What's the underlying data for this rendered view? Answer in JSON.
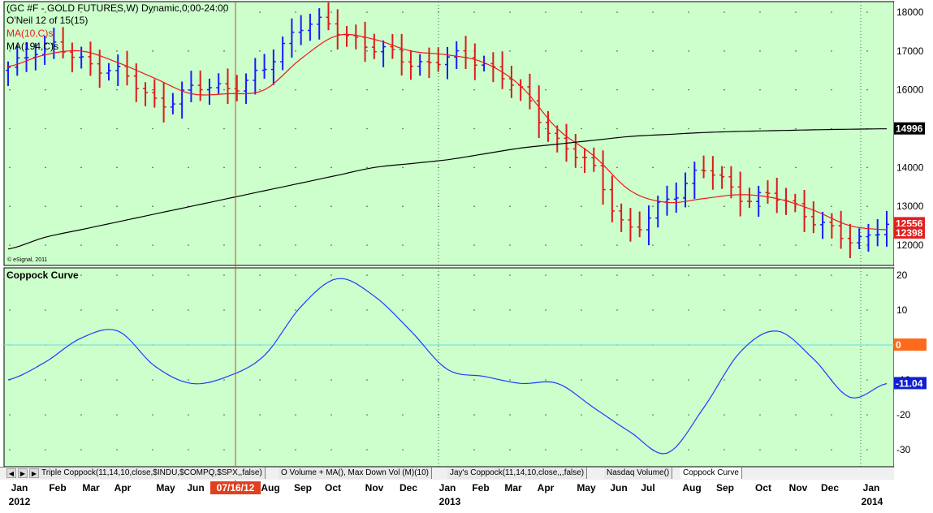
{
  "price_panel": {
    "header_line1": "(GC #F - GOLD FUTURES,W) Dynamic,0:00-24:00",
    "header_line2": "O'Neil 12 of 15(15)",
    "header_line3": "MA(10,C)s",
    "header_line4": "MA(194,C)s",
    "copyright": "© eSignal, 2011",
    "badges": [
      {
        "text": "14996",
        "value": 14996,
        "bg": "#000000",
        "fg": "#ffffff"
      },
      {
        "text": "12556",
        "value": 12556,
        "bg": "#e02020",
        "fg": "#ffffff"
      },
      {
        "text": "12398",
        "value": 12398,
        "bg": "#e02020",
        "fg": "#ffffff"
      }
    ]
  },
  "coppock_panel": {
    "title": "Coppock Curve",
    "badges": [
      {
        "text": "0",
        "value": 0,
        "bg": "#ff6a1a",
        "fg": "#ffffff"
      },
      {
        "text": "-11.04",
        "value": -11.04,
        "bg": "#1020d0",
        "fg": "#ffffff"
      }
    ]
  },
  "cursor_label": "07/16/12",
  "x_axis": {
    "months": [
      "Jan",
      "Feb",
      "Mar",
      "Apr",
      "May",
      "Jun",
      "Aug",
      "Sep",
      "Oct",
      "Nov",
      "Dec",
      "Jan",
      "Feb",
      "Mar",
      "Apr",
      "May",
      "Jun",
      "Jul",
      "Aug",
      "Sep",
      "Oct",
      "Nov",
      "Dec",
      "Jan"
    ],
    "years": [
      "2012",
      "2013",
      "2014"
    ]
  },
  "tabs": [
    "Triple Coppock(11,14,10,close,$INDU,$COMPQ,$SPX,,false)",
    "O Volume + MA(), Max Down Vol (M)(10)",
    "Jay's Coppock(11,14,10,close,,,false)",
    "Nasdaq Volume()",
    "Coppock Curve"
  ],
  "colors": {
    "panel_bg": "#ccffcc",
    "up_bar": "#1a1aff",
    "down_bar": "#dd1a1a",
    "ma10": "#ee1a1a",
    "ma194": "#000000",
    "coppock": "#1a3cff",
    "zero_line": "#66dddd",
    "cursor": "#e04020"
  },
  "chart_data": [
    {
      "type": "line",
      "title": "(GC #F - GOLD FUTURES,W) Dynamic,0:00-24:00",
      "note_series_type": "weekly OHLC bars with moving averages",
      "ylim": [
        11500,
        18300
      ],
      "yticks": [
        12000,
        13000,
        14000,
        15000,
        16000,
        17000,
        18000
      ],
      "x": [
        "2012-01",
        "2012-02",
        "2012-03",
        "2012-04",
        "2012-05",
        "2012-06",
        "2012-07",
        "2012-08",
        "2012-09",
        "2012-10",
        "2012-11",
        "2012-12",
        "2013-01",
        "2013-02",
        "2013-03",
        "2013-04",
        "2013-05",
        "2013-06",
        "2013-07",
        "2013-08",
        "2013-09",
        "2013-10",
        "2013-11",
        "2013-12",
        "2014-01"
      ],
      "series": [
        {
          "name": "GC #F close",
          "values": [
            16500,
            17200,
            16700,
            16500,
            15700,
            16000,
            16100,
            16500,
            17700,
            17500,
            17100,
            16700,
            16800,
            16700,
            15900,
            14700,
            13900,
            12400,
            13200,
            13900,
            13300,
            13200,
            12700,
            12100,
            12556
          ]
        },
        {
          "name": "MA(10,C)s",
          "values": [
            16600,
            16900,
            17000,
            16700,
            16300,
            15900,
            15900,
            16000,
            16800,
            17400,
            17300,
            17000,
            16900,
            16700,
            16100,
            15000,
            14300,
            13400,
            13100,
            13200,
            13300,
            13200,
            12900,
            12500,
            12398
          ]
        },
        {
          "name": "MA(194,C)s",
          "values": [
            11900,
            12200,
            12400,
            12600,
            12800,
            13000,
            13200,
            13400,
            13600,
            13800,
            14000,
            14100,
            14200,
            14350,
            14500,
            14600,
            14700,
            14800,
            14850,
            14900,
            14930,
            14950,
            14970,
            14985,
            14996
          ]
        }
      ]
    },
    {
      "type": "line",
      "title": "Coppock Curve",
      "ylim": [
        -34,
        22
      ],
      "yticks": [
        -30,
        -20,
        -10,
        0,
        10,
        20
      ],
      "x": [
        "2012-01",
        "2012-02",
        "2012-03",
        "2012-04",
        "2012-05",
        "2012-06",
        "2012-07",
        "2012-08",
        "2012-09",
        "2012-10",
        "2012-11",
        "2012-12",
        "2013-01",
        "2013-02",
        "2013-03",
        "2013-04",
        "2013-05",
        "2013-06",
        "2013-07",
        "2013-08",
        "2013-09",
        "2013-10",
        "2013-11",
        "2013-12",
        "2014-01"
      ],
      "series": [
        {
          "name": "Coppock Curve",
          "values": [
            -10,
            -5,
            2,
            4,
            -6,
            -11,
            -9,
            -3,
            11,
            19,
            14,
            4,
            -7,
            -9,
            -11,
            -11,
            -18,
            -25,
            -31,
            -18,
            -2,
            4,
            -4,
            -15,
            -11.04
          ]
        }
      ]
    }
  ]
}
